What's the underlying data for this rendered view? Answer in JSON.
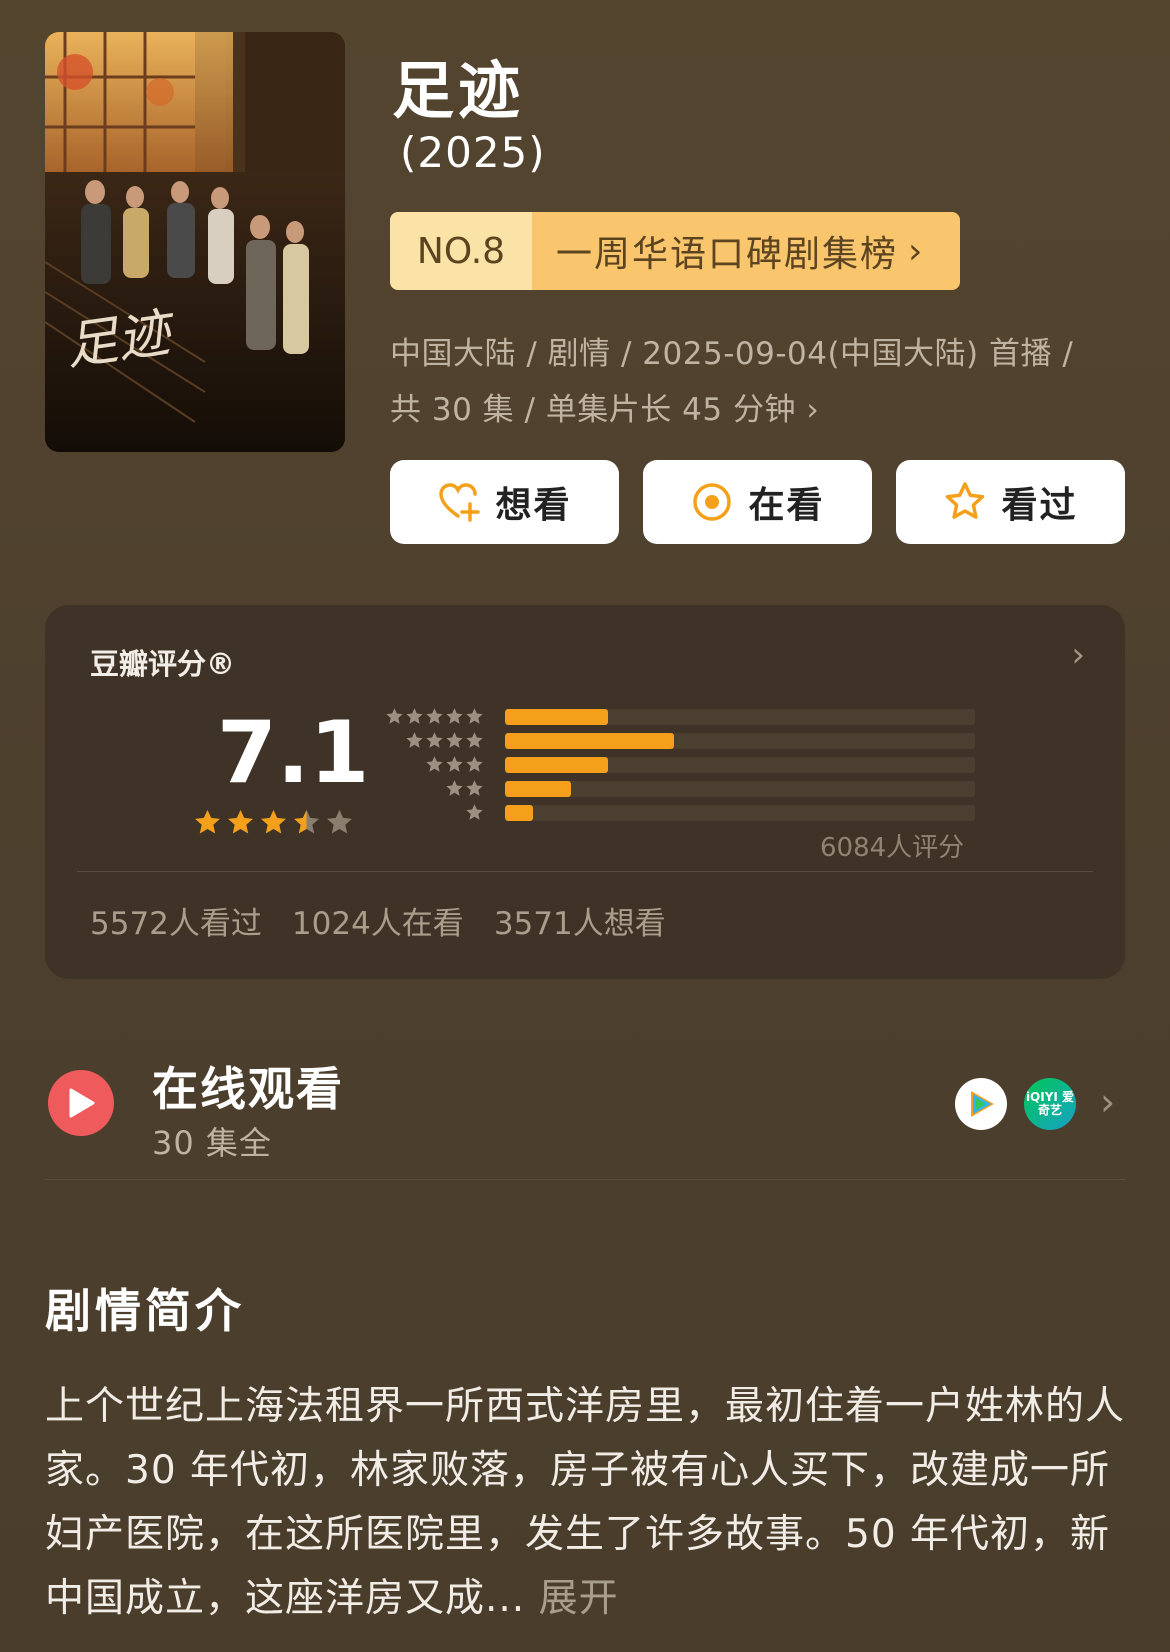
{
  "title": "足迹",
  "year": "(2025)",
  "rank": {
    "number": "NO.8",
    "label": "一周华语口碑剧集榜",
    "chevron": "›"
  },
  "meta": {
    "line1": "中国大陆 / 剧情 / 2025-09-04(中国大陆) 首播 /",
    "line2": "共 30 集 / 单集片长 45 分钟",
    "chevron": "›"
  },
  "actions": [
    {
      "label": "想看",
      "icon": "heart-plus-icon"
    },
    {
      "label": "在看",
      "icon": "target-icon"
    },
    {
      "label": "看过",
      "icon": "star-outline-icon"
    }
  ],
  "rating": {
    "label": "豆瓣评分®",
    "score": "7.1",
    "stars_value": 3.5,
    "distribution": [
      {
        "stars": 5,
        "fraction": 0.22
      },
      {
        "stars": 4,
        "fraction": 0.36
      },
      {
        "stars": 3,
        "fraction": 0.22
      },
      {
        "stars": 2,
        "fraction": 0.14
      },
      {
        "stars": 1,
        "fraction": 0.06
      }
    ],
    "count_text": "6084人评分",
    "stats": [
      "5572人看过",
      "1024人在看",
      "3571人想看"
    ],
    "chevron": "›"
  },
  "watch": {
    "title": "在线观看",
    "subtitle": "30 集全",
    "platforms": [
      "tencent-video-icon",
      "iqiyi-icon"
    ],
    "iqiyi_text": "iQIYI 爱奇艺",
    "chevron": "›"
  },
  "synopsis": {
    "title": "剧情简介",
    "text": "上个世纪上海法租界一所西式洋房里，最初住着一户姓林的人家。30 年代初，林家败落，房子被有心人买下，改建成一所妇产医院，在这所医院里，发生了许多故事。50 年代初，新中国成立，这座洋房又成...",
    "expand": "展开"
  },
  "colors": {
    "background": "#4f4130",
    "accent_orange": "#f5a01a",
    "rank_bg": "#f9c56d",
    "card_bg": "#3e3326"
  }
}
